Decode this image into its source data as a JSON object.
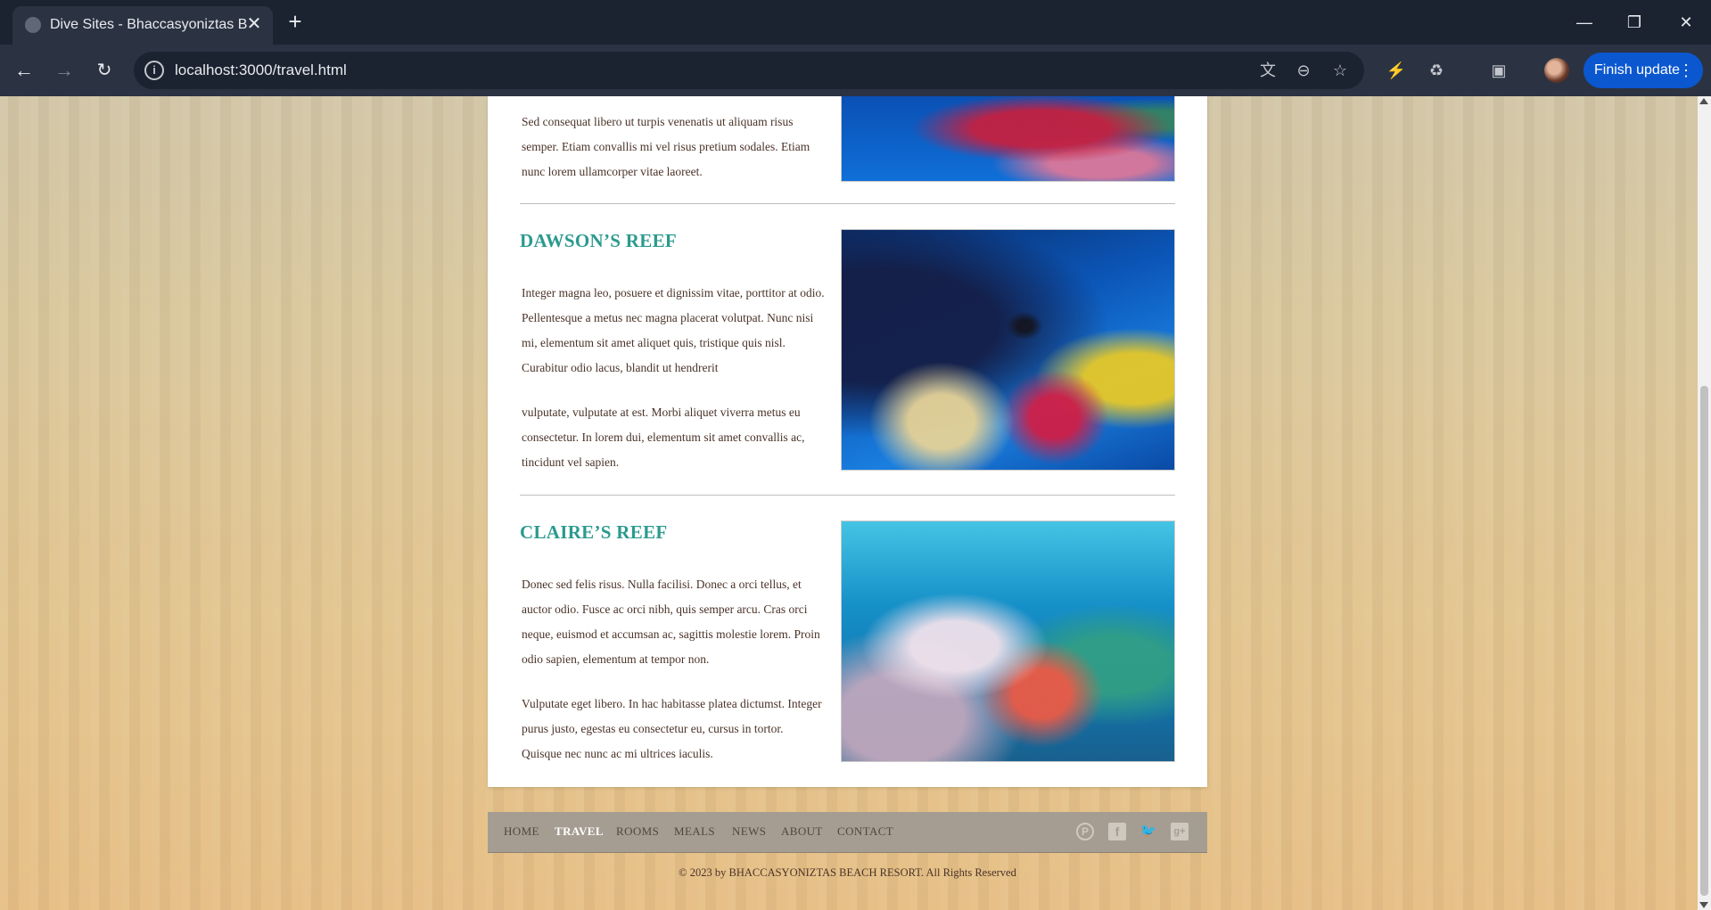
{
  "browser": {
    "tab_title": "Dive Sites - Bhaccasyoniztas Beach Resort",
    "tab_close": "✕",
    "new_tab": "+",
    "url": "localhost:3000/travel.html",
    "update_label": "Finish update",
    "icons": [
      "back-icon",
      "forward-icon",
      "reload-icon",
      "info-icon",
      "translate-icon",
      "zoom-out-icon",
      "bookmark-star-icon",
      "eye-off-icon",
      "extensions-icon",
      "tab-search-icon",
      "profile-avatar",
      "menu-dots-icon",
      "minimize-icon",
      "restore-icon",
      "close-icon"
    ]
  },
  "sections": [
    {
      "id": "top",
      "paragraphs": [
        "Sed consequat libero ut turpis venenatis ut aliquam risus semper. Etiam convallis mi vel risus pretium sodales. Etiam nunc lorem ullamcorper vitae laoreet."
      ]
    },
    {
      "id": "dawson",
      "title": "DAWSON’S REEF",
      "paragraphs": [
        "Integer magna leo, posuere et dignissim vitae, porttitor at odio. Pellentesque a metus nec magna placerat volutpat. Nunc nisi mi, elementum sit amet aliquet quis, tristique quis nisl. Curabitur odio lacus, blandit ut hendrerit",
        "vulputate, vulputate at est. Morbi aliquet viverra metus eu consectetur. In lorem dui, elementum sit amet convallis ac, tincidunt vel sapien."
      ]
    },
    {
      "id": "claire",
      "title": "CLAIRE’S REEF",
      "paragraphs": [
        "Donec sed felis risus. Nulla facilisi. Donec a orci tellus, et auctor odio. Fusce ac orci nibh, quis semper arcu. Cras orci neque, euismod et accumsan ac, sagittis molestie lorem. Proin odio sapien, elementum at tempor non.",
        "Vulputate eget libero. In hac habitasse platea dictumst. Integer purus justo, egestas eu consectetur eu, cursus in tortor. Quisque nec nunc ac mi ultrices iaculis."
      ]
    }
  ],
  "footer": {
    "nav": [
      "HOME",
      "TRAVEL",
      "ROOMS",
      "MEALS",
      "NEWS",
      "ABOUT",
      "CONTACT"
    ],
    "active": "TRAVEL",
    "social": [
      {
        "name": "pinterest-icon",
        "glyph": "P"
      },
      {
        "name": "facebook-icon",
        "glyph": "f"
      },
      {
        "name": "twitter-icon",
        "glyph": "🐦"
      },
      {
        "name": "google-plus-icon",
        "glyph": "g+"
      }
    ],
    "copyright": "© 2023 by BHACCASYONIZTAS BEACH RESORT. All Rights Reserved"
  },
  "colors": {
    "heading": "#2b9a8e",
    "body_text": "#4a3328",
    "footer_bar": "#a69d92",
    "browser_frame": "#1b2331",
    "update_button": "#0b57d0"
  }
}
